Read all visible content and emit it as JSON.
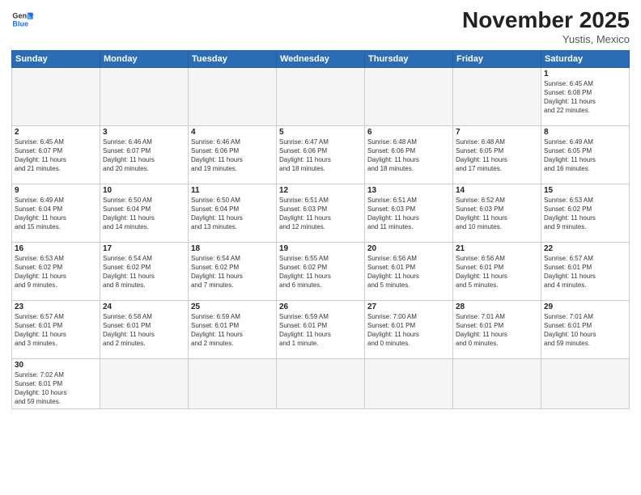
{
  "header": {
    "logo_line1": "General",
    "logo_line2": "Blue",
    "month": "November 2025",
    "location": "Yustis, Mexico"
  },
  "weekdays": [
    "Sunday",
    "Monday",
    "Tuesday",
    "Wednesday",
    "Thursday",
    "Friday",
    "Saturday"
  ],
  "weeks": [
    [
      {
        "day": "",
        "info": ""
      },
      {
        "day": "",
        "info": ""
      },
      {
        "day": "",
        "info": ""
      },
      {
        "day": "",
        "info": ""
      },
      {
        "day": "",
        "info": ""
      },
      {
        "day": "",
        "info": ""
      },
      {
        "day": "1",
        "info": "Sunrise: 6:45 AM\nSunset: 6:08 PM\nDaylight: 11 hours\nand 22 minutes."
      }
    ],
    [
      {
        "day": "2",
        "info": "Sunrise: 6:45 AM\nSunset: 6:07 PM\nDaylight: 11 hours\nand 21 minutes."
      },
      {
        "day": "3",
        "info": "Sunrise: 6:46 AM\nSunset: 6:07 PM\nDaylight: 11 hours\nand 20 minutes."
      },
      {
        "day": "4",
        "info": "Sunrise: 6:46 AM\nSunset: 6:06 PM\nDaylight: 11 hours\nand 19 minutes."
      },
      {
        "day": "5",
        "info": "Sunrise: 6:47 AM\nSunset: 6:06 PM\nDaylight: 11 hours\nand 18 minutes."
      },
      {
        "day": "6",
        "info": "Sunrise: 6:48 AM\nSunset: 6:06 PM\nDaylight: 11 hours\nand 18 minutes."
      },
      {
        "day": "7",
        "info": "Sunrise: 6:48 AM\nSunset: 6:05 PM\nDaylight: 11 hours\nand 17 minutes."
      },
      {
        "day": "8",
        "info": "Sunrise: 6:49 AM\nSunset: 6:05 PM\nDaylight: 11 hours\nand 16 minutes."
      }
    ],
    [
      {
        "day": "9",
        "info": "Sunrise: 6:49 AM\nSunset: 6:04 PM\nDaylight: 11 hours\nand 15 minutes."
      },
      {
        "day": "10",
        "info": "Sunrise: 6:50 AM\nSunset: 6:04 PM\nDaylight: 11 hours\nand 14 minutes."
      },
      {
        "day": "11",
        "info": "Sunrise: 6:50 AM\nSunset: 6:04 PM\nDaylight: 11 hours\nand 13 minutes."
      },
      {
        "day": "12",
        "info": "Sunrise: 6:51 AM\nSunset: 6:03 PM\nDaylight: 11 hours\nand 12 minutes."
      },
      {
        "day": "13",
        "info": "Sunrise: 6:51 AM\nSunset: 6:03 PM\nDaylight: 11 hours\nand 11 minutes."
      },
      {
        "day": "14",
        "info": "Sunrise: 6:52 AM\nSunset: 6:03 PM\nDaylight: 11 hours\nand 10 minutes."
      },
      {
        "day": "15",
        "info": "Sunrise: 6:53 AM\nSunset: 6:02 PM\nDaylight: 11 hours\nand 9 minutes."
      }
    ],
    [
      {
        "day": "16",
        "info": "Sunrise: 6:53 AM\nSunset: 6:02 PM\nDaylight: 11 hours\nand 9 minutes."
      },
      {
        "day": "17",
        "info": "Sunrise: 6:54 AM\nSunset: 6:02 PM\nDaylight: 11 hours\nand 8 minutes."
      },
      {
        "day": "18",
        "info": "Sunrise: 6:54 AM\nSunset: 6:02 PM\nDaylight: 11 hours\nand 7 minutes."
      },
      {
        "day": "19",
        "info": "Sunrise: 6:55 AM\nSunset: 6:02 PM\nDaylight: 11 hours\nand 6 minutes."
      },
      {
        "day": "20",
        "info": "Sunrise: 6:56 AM\nSunset: 6:01 PM\nDaylight: 11 hours\nand 5 minutes."
      },
      {
        "day": "21",
        "info": "Sunrise: 6:56 AM\nSunset: 6:01 PM\nDaylight: 11 hours\nand 5 minutes."
      },
      {
        "day": "22",
        "info": "Sunrise: 6:57 AM\nSunset: 6:01 PM\nDaylight: 11 hours\nand 4 minutes."
      }
    ],
    [
      {
        "day": "23",
        "info": "Sunrise: 6:57 AM\nSunset: 6:01 PM\nDaylight: 11 hours\nand 3 minutes."
      },
      {
        "day": "24",
        "info": "Sunrise: 6:58 AM\nSunset: 6:01 PM\nDaylight: 11 hours\nand 2 minutes."
      },
      {
        "day": "25",
        "info": "Sunrise: 6:59 AM\nSunset: 6:01 PM\nDaylight: 11 hours\nand 2 minutes."
      },
      {
        "day": "26",
        "info": "Sunrise: 6:59 AM\nSunset: 6:01 PM\nDaylight: 11 hours\nand 1 minute."
      },
      {
        "day": "27",
        "info": "Sunrise: 7:00 AM\nSunset: 6:01 PM\nDaylight: 11 hours\nand 0 minutes."
      },
      {
        "day": "28",
        "info": "Sunrise: 7:01 AM\nSunset: 6:01 PM\nDaylight: 11 hours\nand 0 minutes."
      },
      {
        "day": "29",
        "info": "Sunrise: 7:01 AM\nSunset: 6:01 PM\nDaylight: 10 hours\nand 59 minutes."
      }
    ],
    [
      {
        "day": "30",
        "info": "Sunrise: 7:02 AM\nSunset: 6:01 PM\nDaylight: 10 hours\nand 59 minutes."
      },
      {
        "day": "",
        "info": ""
      },
      {
        "day": "",
        "info": ""
      },
      {
        "day": "",
        "info": ""
      },
      {
        "day": "",
        "info": ""
      },
      {
        "day": "",
        "info": ""
      },
      {
        "day": "",
        "info": ""
      }
    ]
  ]
}
